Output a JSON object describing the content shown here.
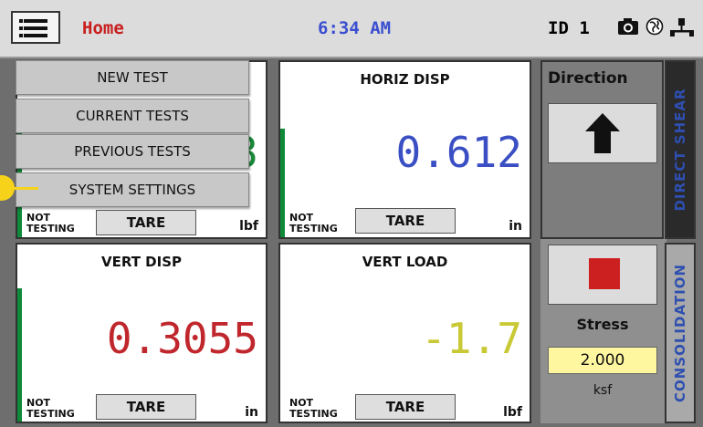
{
  "topbar": {
    "title": "Home",
    "time": "6:34 AM",
    "device_id": "ID 1",
    "icons": [
      "menu-icon",
      "camera-icon",
      "globe-icon",
      "network-icon"
    ]
  },
  "panels": [
    {
      "title": "",
      "value": "3",
      "value_color": "#1a8a3a",
      "status": "NOT\nTESTING",
      "tare": "TARE",
      "unit": "lbf"
    },
    {
      "title": "HORIZ DISP",
      "value": "0.612",
      "value_color": "#3b4fc4",
      "status": "NOT\nTESTING",
      "tare": "TARE",
      "unit": "in"
    },
    {
      "title": "VERT DISP",
      "value": "0.3055",
      "value_color": "#c0272d",
      "status": "NOT\nTESTING",
      "tare": "TARE",
      "unit": "in"
    },
    {
      "title": "VERT LOAD",
      "value": "-1.7",
      "value_color": "#c9c935",
      "status": "NOT\nTESTING",
      "tare": "TARE",
      "unit": "lbf"
    }
  ],
  "menu": {
    "items": [
      "NEW TEST",
      "CURRENT TESTS",
      "PREVIOUS TESTS",
      "SYSTEM SETTINGS"
    ]
  },
  "right": {
    "direction_label": "Direction",
    "tab_direct_shear": "DIRECT SHEAR",
    "tab_consolidation": "CONSOLIDATION",
    "stress_label": "Stress",
    "stress_value": "2.000",
    "stress_unit": "ksf"
  },
  "colors": {
    "accent_red": "#c81e1e",
    "accent_blue": "#3a4fd0",
    "tab_blue": "#2e4fb0",
    "stress_bg": "#fff7a0",
    "callout": "#f6d31a"
  }
}
